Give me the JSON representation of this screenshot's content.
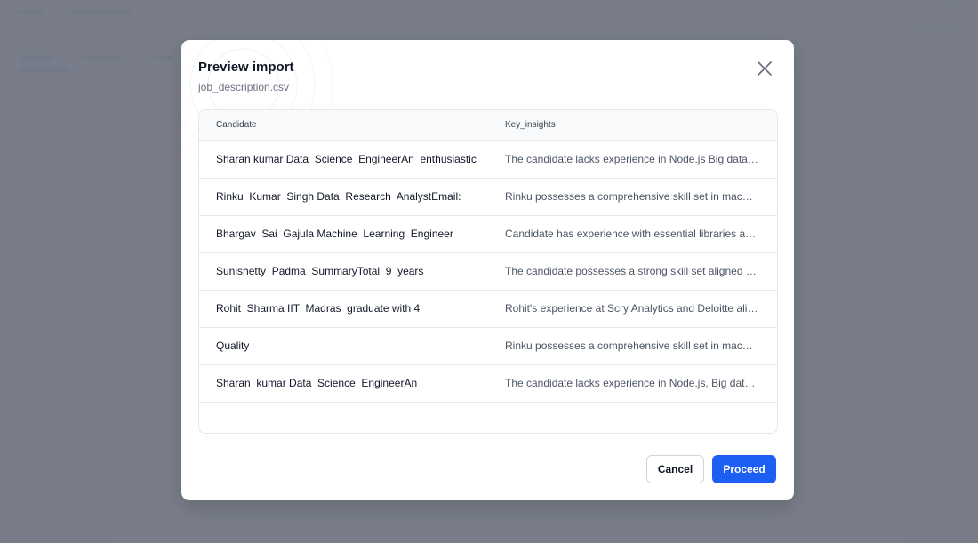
{
  "modal": {
    "title": "Preview import",
    "filename": "job_description.csv",
    "table": {
      "headers": [
        "Candidate",
        "Key_insights"
      ],
      "rows": [
        {
          "candidate": "Sharan kumar Data  Science  EngineerAn  enthusiastic",
          "insight": "The candidate lacks experience in Node.js Big data tools"
        },
        {
          "candidate": "Rinku  Kumar  Singh Data  Research  AnalystEmail:",
          "insight": "Rinku possesses a comprehensive skill set in machine learning"
        },
        {
          "candidate": "Bhargav  Sai  Gajula Machine  Learning  Engineer",
          "insight": "Candidate has experience with essential libraries and frameworks"
        },
        {
          "candidate": "Sunishetty  Padma  SummaryTotal  9  years",
          "insight": "The candidate possesses a strong skill set aligned with the role"
        },
        {
          "candidate": "Rohit  Sharma IIT  Madras  graduate with 4",
          "insight": "Rohit's experience at Scry Analytics and Deloitte aligns well"
        },
        {
          "candidate": "Quality",
          "insight": "Rinku possesses a comprehensive skill set in machine learning"
        },
        {
          "candidate": "Sharan  kumar Data  Science  EngineerAn",
          "insight": "The candidate lacks experience in Node.js, Big data tools"
        }
      ]
    },
    "buttons": {
      "cancel": "Cancel",
      "proceed": "Proceed"
    }
  },
  "colors": {
    "primary": "#1d5ff2",
    "overlay": "#6e7380"
  },
  "icons": {
    "close": "close-icon"
  }
}
